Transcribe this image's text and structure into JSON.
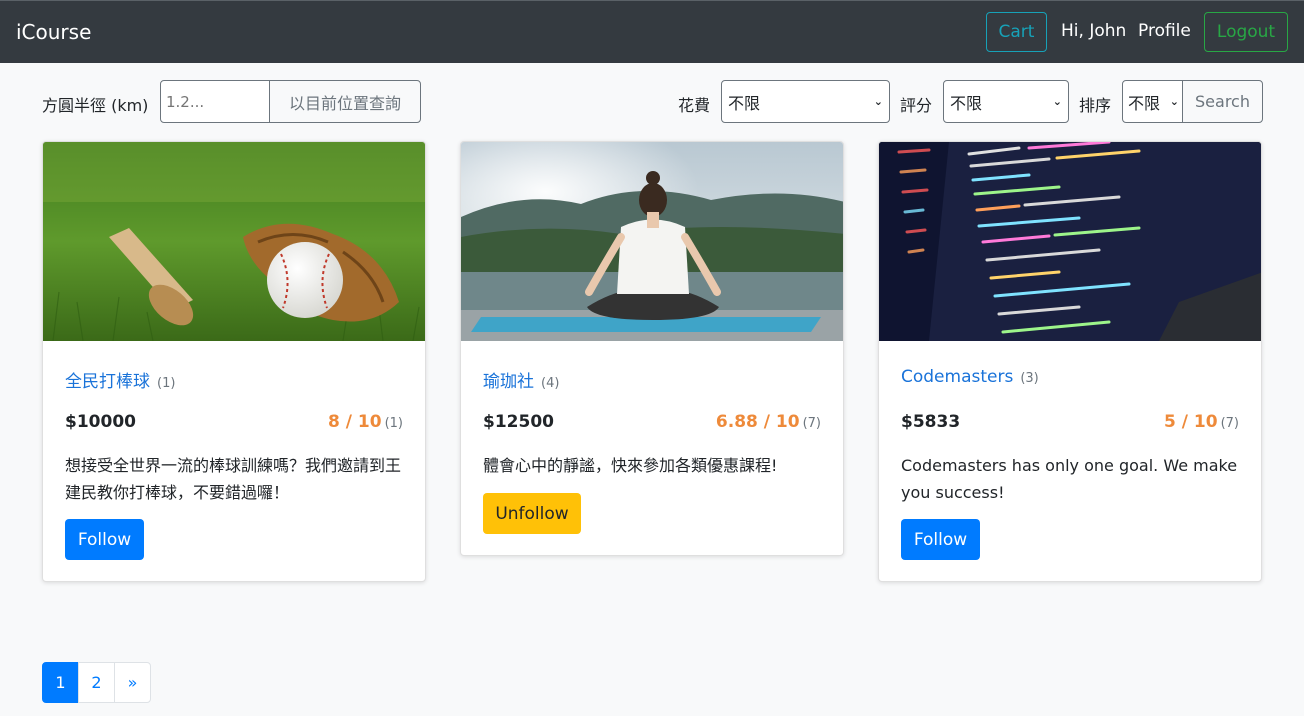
{
  "navbar": {
    "brand": "iCourse",
    "cart_label": "Cart",
    "greeting": "Hi, John",
    "profile_label": "Profile",
    "logout_label": "Logout"
  },
  "filters": {
    "radius_label": "方圓半徑 (km)",
    "radius_placeholder": "1.2...",
    "locate_button": "以目前位置查詢",
    "cost_label": "花費",
    "cost_value": "不限",
    "rating_label": "評分",
    "rating_value": "不限",
    "sort_label": "排序",
    "sort_value": "不限",
    "search_button": "Search"
  },
  "courses": [
    {
      "title": "全民打棒球",
      "follower_count": "(1)",
      "price": "$10000",
      "rating": "8 / 10",
      "rating_count": "(1)",
      "description": "想接受全世界一流的棒球訓練嗎？我們邀請到王建民教你打棒球，不要錯過囉！",
      "action_label": "Follow",
      "image": "baseball-photo"
    },
    {
      "title": "瑜珈社",
      "follower_count": "(4)",
      "price": "$12500",
      "rating": "6.88 / 10",
      "rating_count": "(7)",
      "description": "體會心中的靜謐，快來參加各類優惠課程!",
      "action_label": "Unfollow",
      "image": "yoga-photo"
    },
    {
      "title": "Codemasters",
      "follower_count": "(3)",
      "price": "$5833",
      "rating": "5 / 10",
      "rating_count": "(7)",
      "description": "Codemasters has only one goal. We make you success!",
      "action_label": "Follow",
      "image": "code-screen-photo"
    }
  ],
  "pagination": {
    "pages": [
      "1",
      "2"
    ],
    "next": "»",
    "active_page": "1"
  },
  "colors": {
    "navbar_bg": "#343a40",
    "primary": "#007bff",
    "warning": "#ffc107",
    "info": "#17a2b8",
    "success": "#28a745",
    "rating": "#ee8a3a",
    "link": "#1a73d9"
  }
}
